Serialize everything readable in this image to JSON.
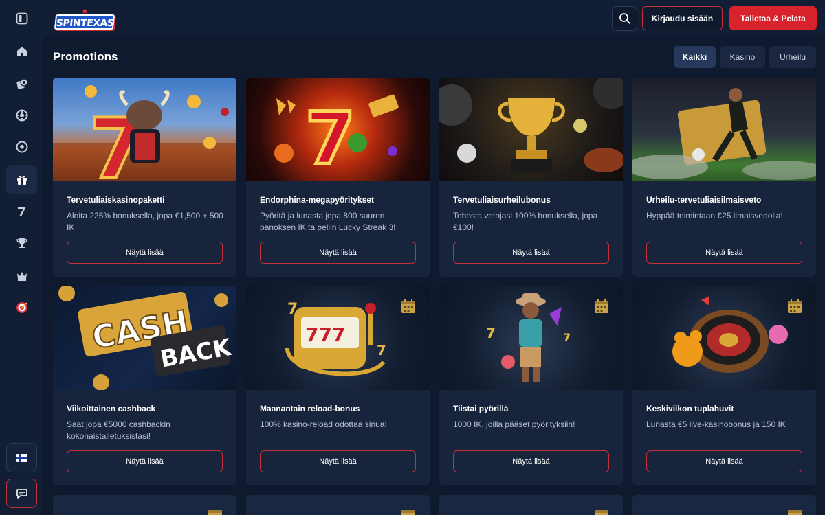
{
  "brand": {
    "name": "SPINTEXAS"
  },
  "header": {
    "login_label": "Kirjaudu sisään",
    "deposit_label": "Talletaa & Pelata"
  },
  "page": {
    "title": "Promotions"
  },
  "filters": [
    {
      "label": "Kaikki",
      "active": true
    },
    {
      "label": "Kasino",
      "active": false
    },
    {
      "label": "Urheilu",
      "active": false
    }
  ],
  "sidebar": {
    "items": [
      {
        "icon": "collapse-icon"
      },
      {
        "icon": "home-icon"
      },
      {
        "icon": "casino-chip-icon"
      },
      {
        "icon": "roulette-icon"
      },
      {
        "icon": "soccer-ball-icon"
      },
      {
        "icon": "gift-icon",
        "active": true
      },
      {
        "icon": "seven-icon"
      },
      {
        "icon": "trophy-icon"
      },
      {
        "icon": "crown-icon"
      },
      {
        "icon": "target-icon"
      }
    ],
    "language_icon": "finland-flag-icon",
    "chat_icon": "chat-icon"
  },
  "promotions": [
    {
      "title": "Tervetuliaiskasinopaketti",
      "desc": "Aloita 225% bonuksella, jopa €1,500 + 500 IK",
      "button": "Näytä lisää"
    },
    {
      "title": "Endorphina-megapyöritykset",
      "desc": "Pyöritä ja lunasta jopa 800 suuren panoksen IK:ta peliin Lucky Streak 3!",
      "button": "Näytä lisää"
    },
    {
      "title": "Tervetuliaisurheilubonus",
      "desc": "Tehosta vetojasi 100% bonuksella, jopa €100!",
      "button": "Näytä lisää"
    },
    {
      "title": "Urheilu-tervetuliaisilmaisveto",
      "desc": "Hyppää toimintaan €25 ilmaisvedolla!",
      "button": "Näytä lisää"
    },
    {
      "title": "Viikoittainen cashback",
      "desc": "Saat jopa €5000 cashbackin kokonaistalletuksistasi!",
      "button": "Näytä lisää"
    },
    {
      "title": "Maanantain reload-bonus",
      "desc": "100% kasino-reload odottaa sinua!",
      "button": "Näytä lisää"
    },
    {
      "title": "Tiistai pyörillä",
      "desc": "1000 IK, joilla pääset pyörityksiin!",
      "button": "Näytä lisää"
    },
    {
      "title": "Keskiviikon tuplahuvit",
      "desc": "Lunasta €5 live-kasinobonus ja 150 IK",
      "button": "Näytä lisää"
    }
  ],
  "cashback_art": {
    "line1": "CASH",
    "line2": "BACK"
  },
  "colors": {
    "accent_red": "#d8232d",
    "outline_red": "#c62f3a",
    "bg": "#0f1a2e",
    "card": "#18243b"
  }
}
